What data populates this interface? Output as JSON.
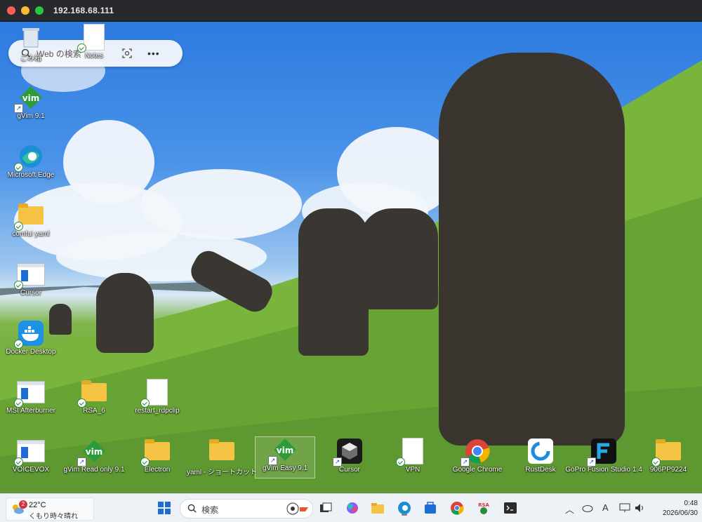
{
  "window": {
    "title": "192.168.68.111"
  },
  "edge_search": {
    "placeholder": "Web の検索"
  },
  "desktop_icons": {
    "recycle_bin": {
      "label": "ごみ箱"
    },
    "notes": {
      "label": "Notes"
    },
    "gvim91": {
      "label": "gVim 9.1"
    },
    "edge": {
      "label": "Microsoft Edge"
    },
    "comfui": {
      "label": "comfui yaml"
    },
    "cursor_left": {
      "label": "Cursor"
    },
    "docker": {
      "label": "Docker Desktop"
    },
    "msi": {
      "label": "MSI Afterburner"
    },
    "rsa": {
      "label": "RSA_6"
    },
    "restart": {
      "label": "restart_rdpclip"
    },
    "voicevox": {
      "label": "VOICEVOX"
    },
    "gvim_readonly": {
      "label": "gVim Read only 9.1"
    },
    "electron": {
      "label": "Electron"
    },
    "yaml_shortcut": {
      "label": "yaml - ショートカット"
    },
    "gvim_easy": {
      "label": "gVim Easy 9.1"
    },
    "cursor_bottom": {
      "label": "Cursor"
    },
    "vpn": {
      "label": "VPN"
    },
    "chrome": {
      "label": "Google Chrome"
    },
    "rustdesk": {
      "label": "RustDesk"
    },
    "gopro": {
      "label": "GoPro Fusion Studio 1.4"
    },
    "folder_906": {
      "label": "906PP9224"
    }
  },
  "taskbar": {
    "weather": {
      "temp": "22°C",
      "condition": "くもり時々晴れ",
      "badge": "2"
    },
    "search_placeholder": "検索",
    "clock": {
      "time": "0:48",
      "date": "2026/06/30"
    },
    "ime": "A"
  },
  "colors": {
    "accent": "#1c6ed4",
    "taskbar": "#eef2f6"
  }
}
